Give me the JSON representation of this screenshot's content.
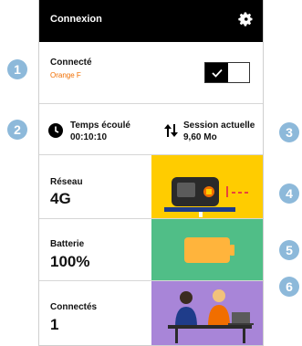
{
  "header": {
    "title": "Connexion",
    "settings_icon": "gear-icon"
  },
  "connection": {
    "status": "Connecté",
    "operator": "Orange F",
    "toggle_state": "on"
  },
  "stats": {
    "elapsed": {
      "label": "Temps écoulé",
      "value": "00:10:10",
      "icon": "clock-icon"
    },
    "session": {
      "label": "Session actuelle",
      "value": "9,60 Mo",
      "icon": "transfer-arrows-icon"
    }
  },
  "tiles": [
    {
      "label": "Réseau",
      "value": "4G",
      "color": "#ffcc00"
    },
    {
      "label": "Batterie",
      "value": "100%",
      "color": "#50be87"
    },
    {
      "label": "Connectés",
      "value": "1",
      "color": "#a885d8"
    }
  ],
  "badges": [
    "1",
    "2",
    "3",
    "4",
    "5",
    "6"
  ],
  "colors": {
    "accent": "#f16e00",
    "badge": "#8db9da"
  }
}
